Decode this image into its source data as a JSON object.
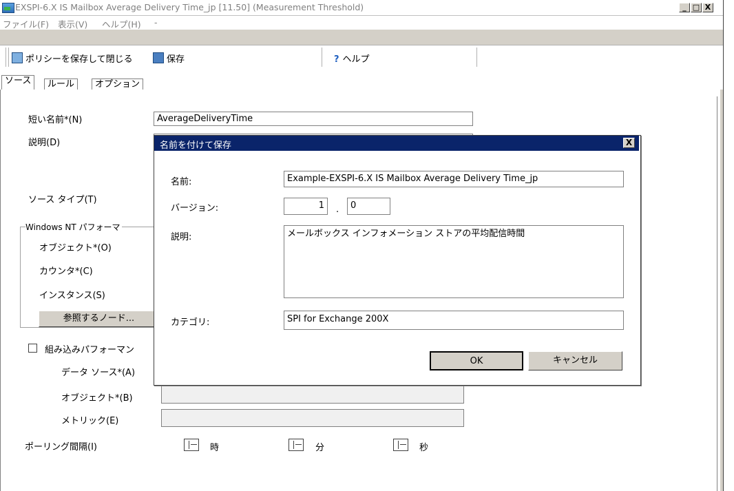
{
  "window": {
    "title": "EXSPI-6.X IS Mailbox Average Delivery Time_jp [11.50] (Measurement Threshold)",
    "minimize": "_",
    "maximize": "□",
    "close": "X"
  },
  "menu": {
    "file": "ファイル(F)",
    "view": "表示(V)",
    "help": "ヘルプ(H)",
    "trailing": "-"
  },
  "toolbar": {
    "save_close": "ポリシーを保存して閉じる",
    "save": "保存",
    "help": "ヘルプ"
  },
  "tabs": [
    "ソース",
    "ルール",
    "オプション"
  ],
  "form": {
    "short_name_label": "短い名前*(N)",
    "short_name_value": "AverageDeliveryTime",
    "description_label": "説明(D)",
    "source_type_label": "ソース タイプ(T)",
    "nt_group_label": "Windows NT パフォーマ",
    "object_label": "オブジェクト*(O)",
    "counter_label": "カウンタ*(C)",
    "instance_label": "インスタンス(S)",
    "browse_button": "参照するノード...",
    "embedded_label": "組み込みパフォーマン",
    "data_source_label": "データ ソース*(A)",
    "object2_label": "オブジェクト*(B)",
    "metric_label": "メトリック(E)",
    "polling_label": "ポーリング間隔(I)",
    "hours": "時",
    "minutes": "分",
    "seconds": "秒"
  },
  "dialog": {
    "title": "名前を付けて保存",
    "name_label": "名前:",
    "name_value": "Example-EXSPI-6.X IS Mailbox Average Delivery Time_jp",
    "version_label": "バージョン:",
    "version_major": "1",
    "version_dot": ".",
    "version_minor": "0",
    "description_label": "説明:",
    "description_value": "メールボックス インフォメーション ストアの平均配信時間",
    "category_label": "カテゴリ:",
    "category_value": "SPI for Exchange 200X",
    "ok": "OK",
    "cancel": "キャンセル",
    "close": "X"
  }
}
